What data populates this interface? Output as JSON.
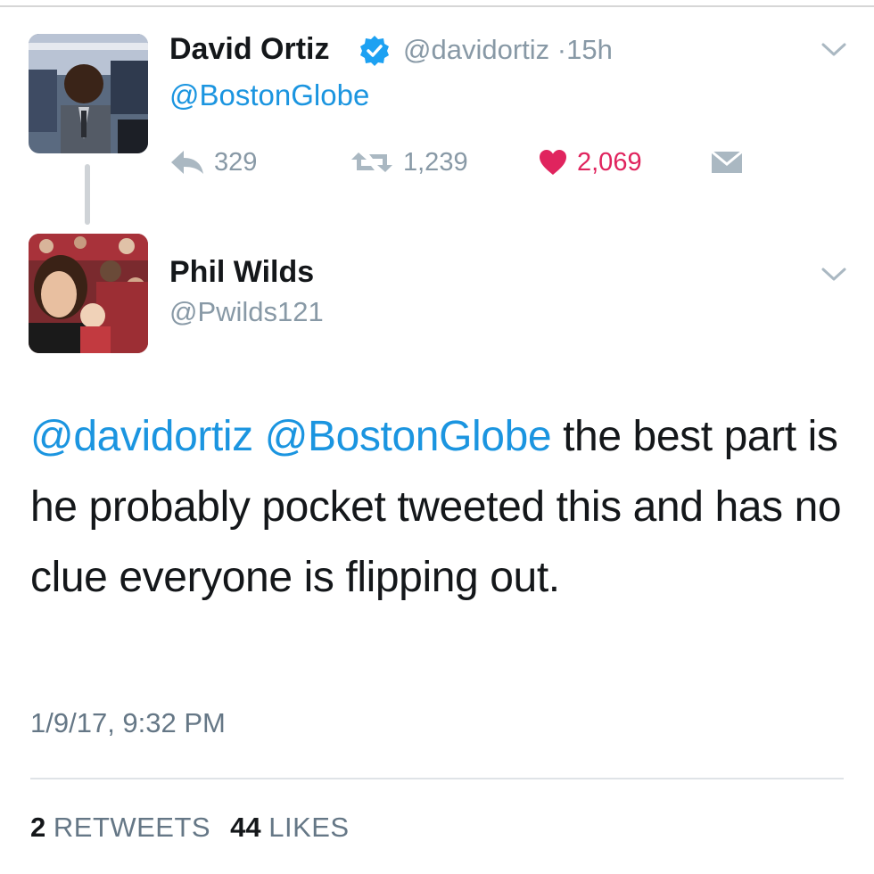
{
  "tweet_parent": {
    "author_name": "David Ortiz",
    "handle": "@davidortiz",
    "separator": "·",
    "time_ago": "15h",
    "text": "@BostonGlobe",
    "actions": {
      "replies": "329",
      "retweets": "1,239",
      "likes": "2,069"
    }
  },
  "tweet_main": {
    "author_name": "Phil Wilds",
    "handle": "@Pwilds121",
    "mention_1": "@davidortiz",
    "mention_2": "@BostonGlobe",
    "text_rest": "the best part is he probably pocket tweeted this and has no clue everyone is flipping out.",
    "timestamp": "1/9/17, 9:32 PM",
    "retweet_count": "2",
    "retweet_label": "RETWEETS",
    "like_count": "44",
    "like_label": "LIKES"
  },
  "colors": {
    "link_blue": "#1b95e0",
    "like_red": "#e0245e",
    "muted_gray": "#8899a6",
    "text_dark": "#14171a"
  },
  "icons": [
    "verified-badge-icon",
    "chevron-down-icon",
    "reply-icon",
    "retweet-icon",
    "heart-icon",
    "envelope-icon"
  ]
}
